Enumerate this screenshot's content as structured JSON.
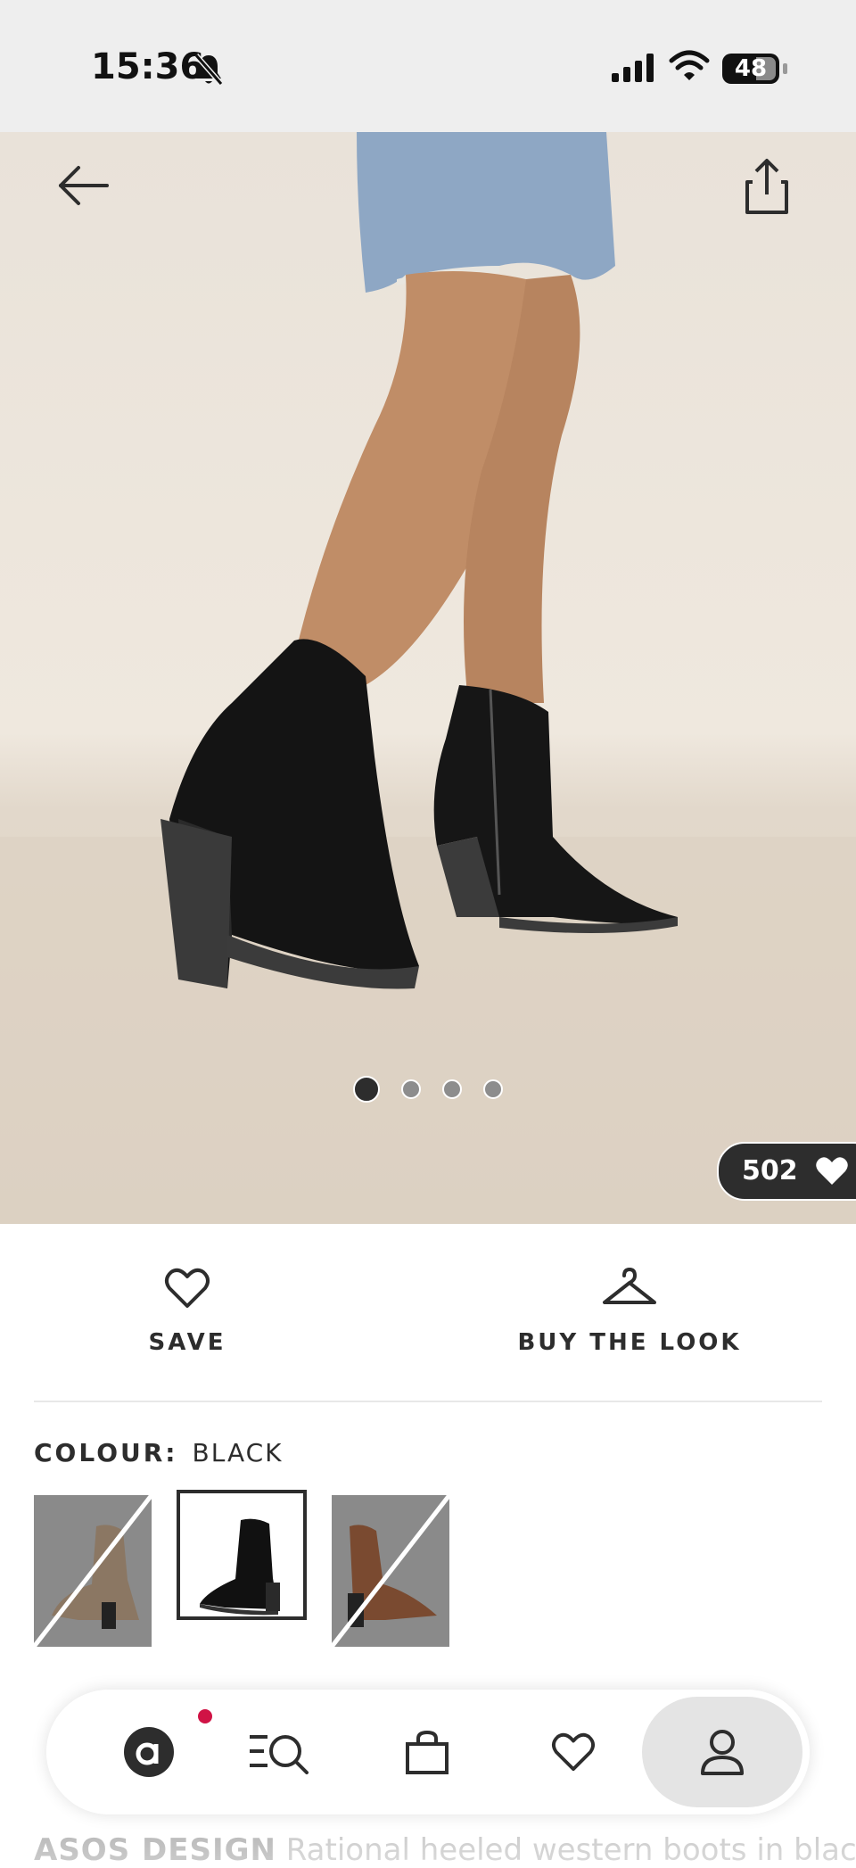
{
  "status_bar": {
    "time": "15:36",
    "battery": "48"
  },
  "hero": {
    "likes_count": "502",
    "active_image": 1,
    "image_count": 4
  },
  "actions": {
    "save_label": "SAVE",
    "buy_the_look_label": "BUY THE LOOK"
  },
  "colour": {
    "label": "COLOUR:",
    "value": "BLACK"
  },
  "product": {
    "brand": "ASOS DESIGN",
    "title": "Rational heeled western boots in black"
  },
  "colors": {
    "accent": "#d01345",
    "text": "#2d2d2d",
    "pill": "#2d2d2d"
  }
}
